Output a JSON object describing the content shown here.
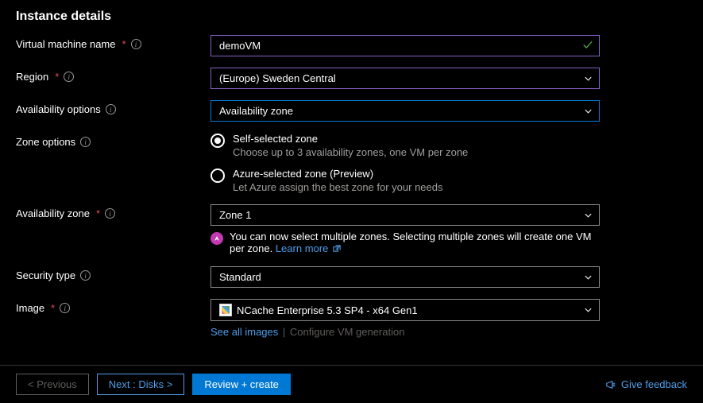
{
  "section_title": "Instance details",
  "labels": {
    "vm_name": "Virtual machine name",
    "region": "Region",
    "availability_options": "Availability options",
    "zone_options": "Zone options",
    "availability_zone": "Availability zone",
    "security_type": "Security type",
    "image": "Image"
  },
  "fields": {
    "vm_name": "demoVM",
    "region": "(Europe) Sweden Central",
    "availability_options": "Availability zone",
    "availability_zone": "Zone 1",
    "security_type": "Standard",
    "image": "NCache Enterprise 5.3 SP4 - x64 Gen1"
  },
  "zone_options": {
    "self": {
      "title": "Self-selected zone",
      "desc": "Choose up to 3 availability zones, one VM per zone"
    },
    "azure": {
      "title": "Azure-selected zone (Preview)",
      "desc": "Let Azure assign the best zone for your needs"
    },
    "selected": "self"
  },
  "banner": {
    "text": "You can now select multiple zones. Selecting multiple zones will create one VM per zone.",
    "link": "Learn more"
  },
  "image_links": {
    "see_all": "See all images",
    "configure": "Configure VM generation"
  },
  "footer": {
    "previous": "< Previous",
    "next": "Next : Disks >",
    "review": "Review + create",
    "feedback": "Give feedback"
  }
}
